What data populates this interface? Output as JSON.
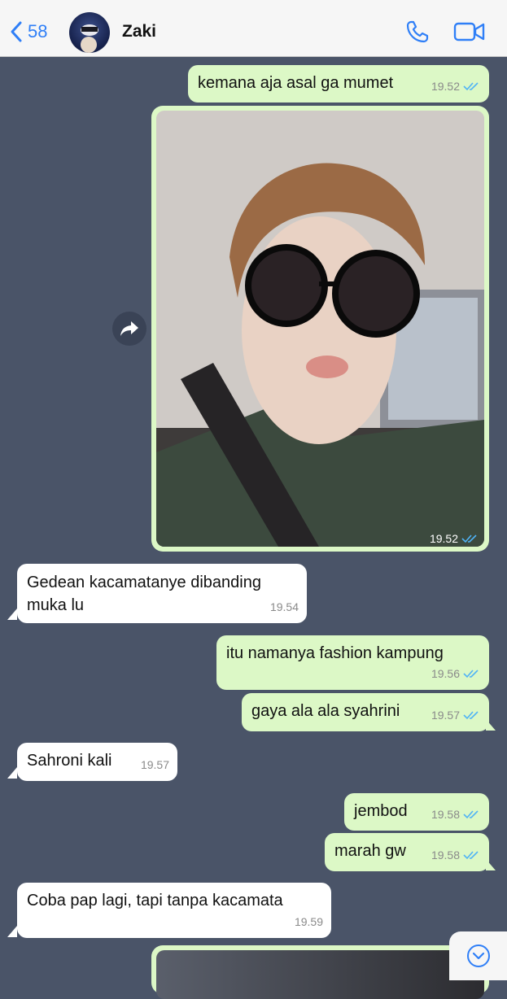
{
  "header": {
    "back_count": "58",
    "contact_name": "Zaki"
  },
  "icons": {
    "back": "chevron-left-icon",
    "call": "phone-icon",
    "video": "video-camera-icon",
    "forward": "forward-share-icon",
    "scroll_down": "chevron-down-circle-icon",
    "read": "double-check-icon"
  },
  "colors": {
    "chat_background": "#4a5468",
    "outgoing_bubble": "#dcf8c6",
    "incoming_bubble": "#ffffff",
    "accent": "#2f7ff7",
    "read_ticks": "#4fb3f6"
  },
  "messages": [
    {
      "dir": "out",
      "text": "kemana aja asal ga mumet",
      "time": "19.52",
      "read": true
    },
    {
      "dir": "out",
      "type": "photo",
      "time": "19.52",
      "read": true
    },
    {
      "dir": "in",
      "text_line1": "Gedean kacamatanye dibanding",
      "text_line2": "muka lu",
      "time": "19.54"
    },
    {
      "dir": "out",
      "text": "itu namanya fashion kampung",
      "time": "19.56",
      "read": true
    },
    {
      "dir": "out",
      "text": "gaya ala ala syahrini",
      "time": "19.57",
      "read": true
    },
    {
      "dir": "in",
      "text": "Sahroni kali",
      "time": "19.57"
    },
    {
      "dir": "out",
      "text": "jembod",
      "time": "19.58",
      "read": true
    },
    {
      "dir": "out",
      "text": "marah gw",
      "time": "19.58",
      "read": true
    },
    {
      "dir": "in",
      "text": "Coba pap lagi, tapi tanpa kacamata",
      "time": "19.59"
    },
    {
      "dir": "out",
      "type": "photo"
    }
  ]
}
